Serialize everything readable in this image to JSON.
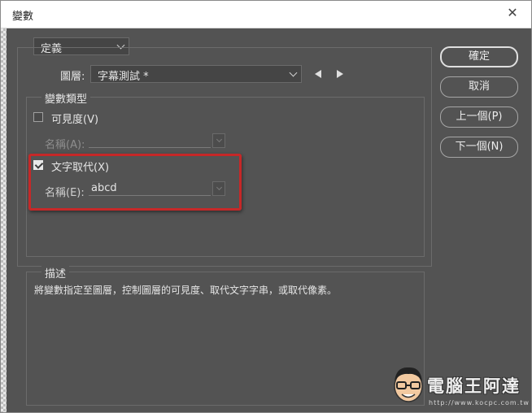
{
  "window": {
    "title": "變數",
    "close_icon": "close-icon"
  },
  "definition_select": {
    "value": "定義"
  },
  "layer": {
    "label": "圖層:",
    "value": "字幕測試 *",
    "prev_icon": "triangle-left-icon",
    "next_icon": "triangle-right-icon"
  },
  "variable_type": {
    "legend": "變數類型",
    "visibility": {
      "label": "可見度(V)",
      "checked": false,
      "name_label": "名稱(A):",
      "name_value": ""
    },
    "text_replace": {
      "label": "文字取代(X)",
      "checked": true,
      "name_label": "名稱(E):",
      "name_value": "abcd"
    }
  },
  "description": {
    "legend": "描述",
    "text": "將變數指定至圖層，控制圖層的可見度、取代文字字串，或取代像素。"
  },
  "buttons": {
    "ok": "確定",
    "cancel": "取消",
    "prev": "上一個(P)",
    "next": "下一個(N)"
  },
  "watermark": {
    "text": "電腦王阿達",
    "url": "http://www.kocpc.com.tw"
  },
  "colors": {
    "dialog_bg": "#535353",
    "highlight": "#c62828"
  }
}
